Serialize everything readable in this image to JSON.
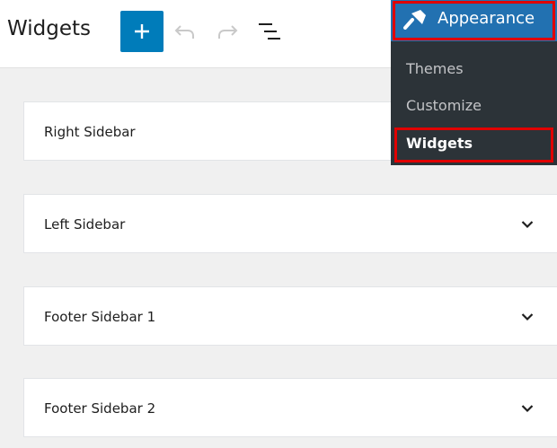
{
  "header": {
    "title": "Widgets",
    "buttons": {
      "add": "plus-icon",
      "undo": "undo-icon",
      "redo": "redo-icon",
      "list_view": "list-view-icon"
    }
  },
  "widget_areas": [
    {
      "label": "Right Sidebar"
    },
    {
      "label": "Left Sidebar"
    },
    {
      "label": "Footer Sidebar 1"
    },
    {
      "label": "Footer Sidebar 2"
    }
  ],
  "admin_menu": {
    "parent": {
      "label": "Appearance",
      "icon": "paintbrush-icon"
    },
    "items": [
      {
        "label": "Themes",
        "current": false
      },
      {
        "label": "Customize",
        "current": false
      },
      {
        "label": "Widgets",
        "current": true
      }
    ]
  },
  "colors": {
    "accent": "#007cba",
    "menu_bg": "#2c3338",
    "menu_active": "#2271b1",
    "highlight": "#e00000",
    "canvas": "#f0f0f0"
  }
}
